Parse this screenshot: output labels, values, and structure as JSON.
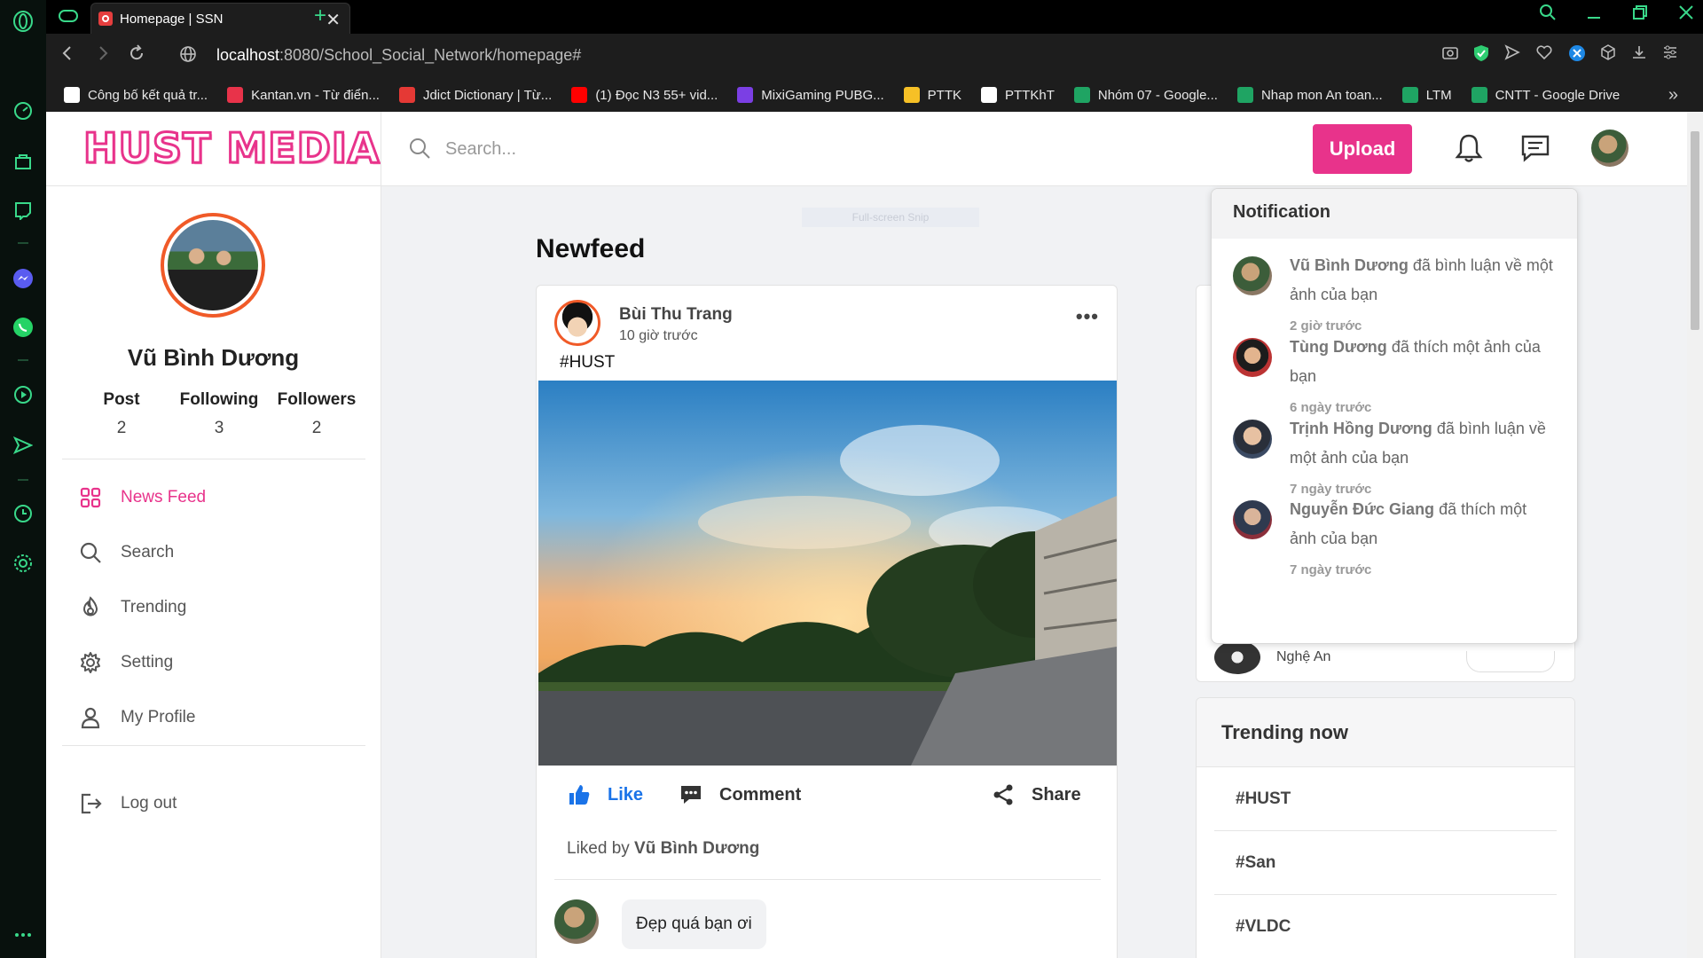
{
  "browser": {
    "tab_title": "Homepage | SSN",
    "url_host": "localhost",
    "url_path": ":8080/School_Social_Network/homepage#",
    "bookmarks": [
      {
        "label": "Công bố kết quả tr...",
        "color": "#ffffff"
      },
      {
        "label": "Kantan.vn - Từ điển...",
        "color": "#e8334a"
      },
      {
        "label": "Jdict Dictionary | Từ...",
        "color": "#e53935"
      },
      {
        "label": "(1) Đọc N3 55+ vid...",
        "color": "#ff0000"
      },
      {
        "label": "MixiGaming PUBG...",
        "color": "#7b3fe4"
      },
      {
        "label": "PTTK",
        "color": "#f6c026"
      },
      {
        "label": "PTTKhT",
        "color": "#ffffff"
      },
      {
        "label": "Nhóm 07 - Google...",
        "color": "#1fa463"
      },
      {
        "label": "Nhap mon An toan...",
        "color": "#1fa463"
      },
      {
        "label": "LTM",
        "color": "#1fa463"
      },
      {
        "label": "CNTT - Google Drive",
        "color": "#1fa463"
      }
    ]
  },
  "app": {
    "logo_text": "HUST MEDIA",
    "search_placeholder": "Search...",
    "upload_label": "Upload",
    "accent": "#e8338b"
  },
  "profile": {
    "name": "Vũ Bình Dương",
    "stats": [
      {
        "label": "Post",
        "value": "2"
      },
      {
        "label": "Following",
        "value": "3"
      },
      {
        "label": "Followers",
        "value": "2"
      }
    ]
  },
  "menu": [
    {
      "label": "News Feed",
      "icon": "grid-icon"
    },
    {
      "label": "Search",
      "icon": "search-icon"
    },
    {
      "label": "Trending",
      "icon": "flame-icon"
    },
    {
      "label": "Setting",
      "icon": "gear-icon"
    },
    {
      "label": "My Profile",
      "icon": "user-icon"
    }
  ],
  "logout_label": "Log out",
  "feed": {
    "title": "Newfeed",
    "snip_text": "Full-screen Snip",
    "post": {
      "author": "Bùi Thu Trang",
      "time": "10 giờ trước",
      "caption": "#HUST",
      "like_label": "Like",
      "comment_label": "Comment",
      "share_label": "Share",
      "liked_by_prefix": "Liked by ",
      "liked_by_name": "Vũ Bình Dương",
      "comment_text": "Đẹp quá bạn ơi"
    }
  },
  "suggest": {
    "location": "Nghệ An"
  },
  "trending": {
    "title": "Trending now",
    "items": [
      "#HUST",
      "#San",
      "#VLDC"
    ]
  },
  "notifications": {
    "title": "Notification",
    "items": [
      {
        "name": "Vũ Bình Dương",
        "action": " đã bình luận về một ảnh của bạn",
        "time": "2 giờ trước"
      },
      {
        "name": "Tùng Dương",
        "action": " đã thích một ảnh của bạn",
        "time": "6 ngày trước"
      },
      {
        "name": "Trịnh Hồng Dương",
        "action": " đã bình luận về một ảnh của bạn",
        "time": "7 ngày trước"
      },
      {
        "name": "Nguyễn Đức Giang",
        "action": " đã thích một ảnh của bạn",
        "time": "7 ngày trước"
      }
    ]
  }
}
